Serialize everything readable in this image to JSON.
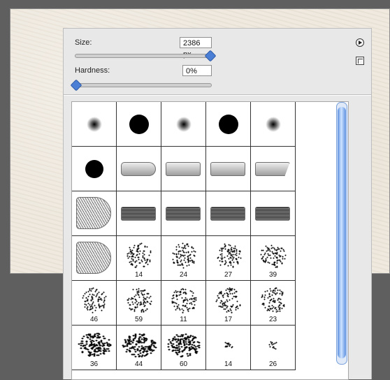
{
  "panel": {
    "size_label": "Size:",
    "size_value": "2386 px",
    "size_slider_fraction": 0.99,
    "hardness_label": "Hardness:",
    "hardness_value": "0%",
    "hardness_slider_fraction": 0.0
  },
  "icons": {
    "flyout": "flyout-menu-icon",
    "new_preset": "new-preset-icon"
  },
  "brushes": [
    {
      "type": "soft",
      "label": ""
    },
    {
      "type": "hard",
      "label": ""
    },
    {
      "type": "soft",
      "label": ""
    },
    {
      "type": "hard",
      "label": ""
    },
    {
      "type": "soft",
      "label": ""
    },
    {
      "type": "hard-small",
      "label": ""
    },
    {
      "type": "brush-round",
      "label": ""
    },
    {
      "type": "brush-flat",
      "label": ""
    },
    {
      "type": "brush-flat",
      "label": ""
    },
    {
      "type": "brush-angle",
      "label": ""
    },
    {
      "type": "brush-fan",
      "label": ""
    },
    {
      "type": "brush-bristle",
      "label": ""
    },
    {
      "type": "brush-bristle",
      "label": ""
    },
    {
      "type": "brush-bristle",
      "label": ""
    },
    {
      "type": "brush-bristle",
      "label": ""
    },
    {
      "type": "brush-fan",
      "label": ""
    },
    {
      "type": "spray",
      "label": "14"
    },
    {
      "type": "spray",
      "label": "24"
    },
    {
      "type": "spray",
      "label": "27"
    },
    {
      "type": "spray",
      "label": "39"
    },
    {
      "type": "spray",
      "label": "46"
    },
    {
      "type": "spray",
      "label": "59"
    },
    {
      "type": "spray",
      "label": "11"
    },
    {
      "type": "spray",
      "label": "17"
    },
    {
      "type": "spray",
      "label": "23"
    },
    {
      "type": "chalk",
      "label": "36"
    },
    {
      "type": "chalk",
      "label": "44"
    },
    {
      "type": "chalk",
      "label": "60"
    },
    {
      "type": "star",
      "label": "14"
    },
    {
      "type": "star",
      "label": "26"
    }
  ],
  "colors": {
    "panel_bg": "#e8e8e8",
    "canvas_bg": "#efe9df",
    "accent": "#4b7fd6"
  }
}
